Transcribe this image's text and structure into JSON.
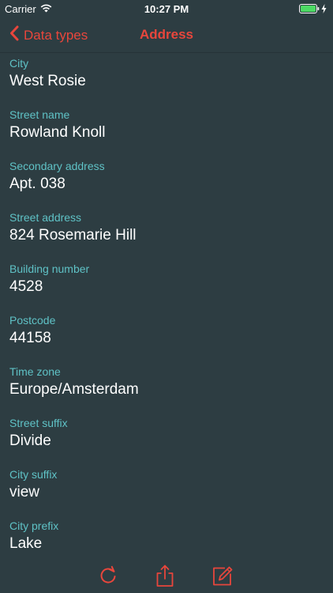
{
  "status_bar": {
    "carrier": "Carrier",
    "time": "10:27 PM"
  },
  "nav": {
    "back_label": "Data types",
    "title": "Address"
  },
  "fields": [
    {
      "label": "City",
      "value": "West Rosie"
    },
    {
      "label": "Street name",
      "value": "Rowland Knoll"
    },
    {
      "label": "Secondary address",
      "value": "Apt. 038"
    },
    {
      "label": "Street address",
      "value": "824 Rosemarie Hill"
    },
    {
      "label": "Building number",
      "value": "4528"
    },
    {
      "label": "Postcode",
      "value": "44158"
    },
    {
      "label": "Time zone",
      "value": "Europe/Amsterdam"
    },
    {
      "label": "Street suffix",
      "value": "Divide"
    },
    {
      "label": "City suffix",
      "value": "view"
    },
    {
      "label": "City prefix",
      "value": "Lake"
    }
  ],
  "toolbar": {
    "icons": [
      "refresh-icon",
      "share-icon",
      "edit-icon"
    ]
  },
  "colors": {
    "background": "#2d3d42",
    "accent": "#e8463c",
    "label": "#5fc2c6",
    "value": "#ffffff",
    "battery": "#4cd964"
  }
}
